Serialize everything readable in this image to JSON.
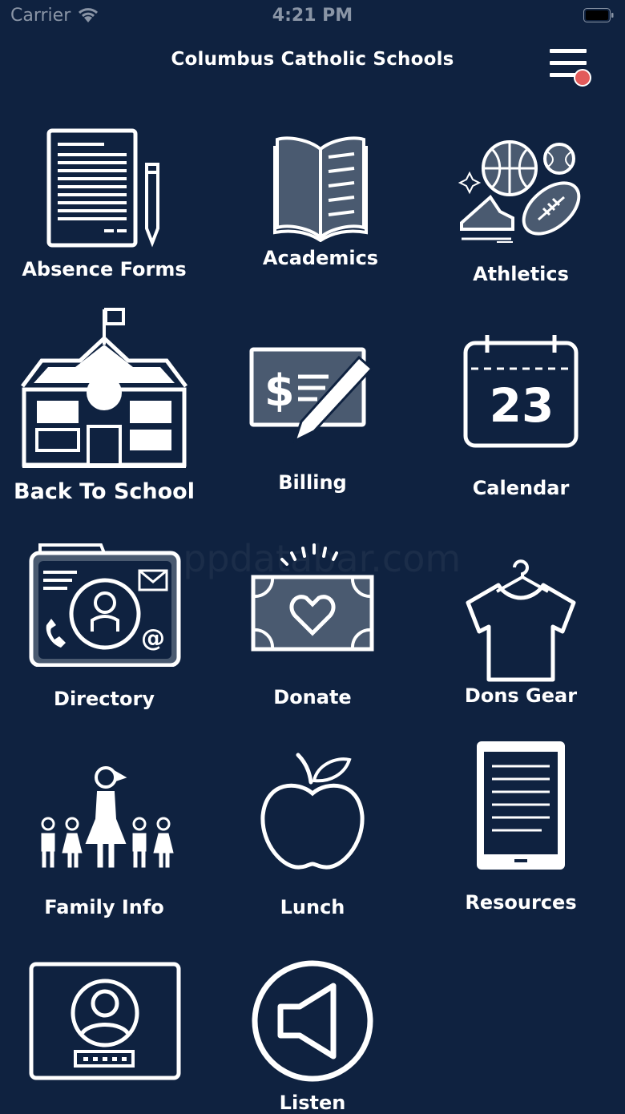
{
  "status_bar": {
    "carrier": "Carrier",
    "time": "4:21 PM"
  },
  "header": {
    "title": "Columbus Catholic Schools"
  },
  "watermark": "appdatabar.com",
  "tiles": [
    {
      "label": "Absence Forms",
      "icon": "document-pencil-icon"
    },
    {
      "label": "Academics",
      "icon": "open-book-icon"
    },
    {
      "label": "Athletics",
      "icon": "sports-balls-icon"
    },
    {
      "label": "Back To School",
      "icon": "school-building-icon"
    },
    {
      "label": "Billing",
      "icon": "check-pen-icon"
    },
    {
      "label": "Calendar",
      "icon": "calendar-icon"
    },
    {
      "label": "Directory",
      "icon": "contact-card-icon"
    },
    {
      "label": "Donate",
      "icon": "heart-banknote-icon"
    },
    {
      "label": "Dons Gear",
      "icon": "tshirt-hanger-icon"
    },
    {
      "label": "Family Info",
      "icon": "family-icon"
    },
    {
      "label": "Lunch",
      "icon": "apple-icon"
    },
    {
      "label": "Resources",
      "icon": "tablet-icon"
    },
    {
      "label": "",
      "icon": "login-profile-icon"
    },
    {
      "label": "Listen",
      "icon": "speaker-icon"
    }
  ],
  "calendar_day": "23",
  "colors": {
    "background": "#0f2240",
    "icon_fill": "#4a5a70",
    "notification_dot": "#e25b5b"
  }
}
